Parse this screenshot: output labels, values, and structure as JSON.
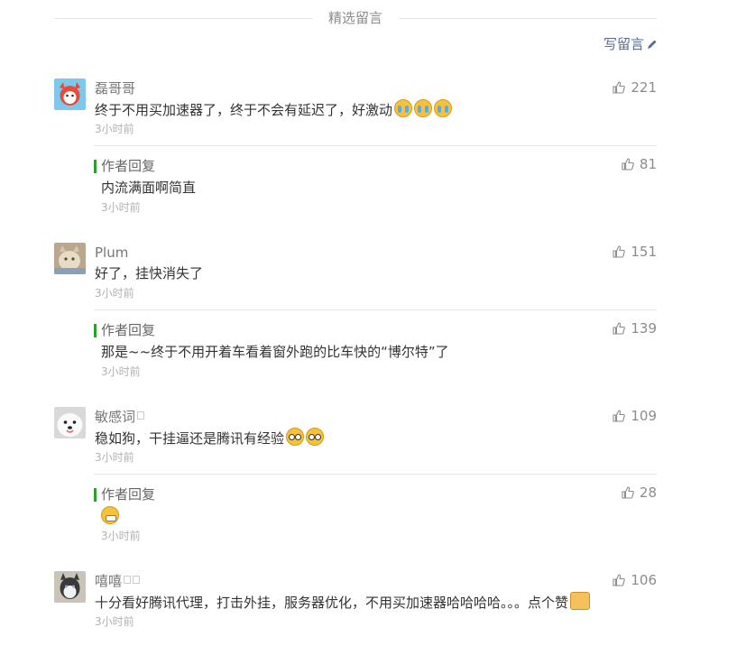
{
  "section_title": "精选留言",
  "write_label": "写留言",
  "colors": {
    "link": "#576b95",
    "reply_bar": "#2ca02c",
    "meta": "#b2b2b2"
  },
  "comments": [
    {
      "nickname": "磊哥哥",
      "text": "终于不用买加速器了，终于不会有延迟了，好激动",
      "emojis": [
        "cry",
        "cry",
        "cry"
      ],
      "time": "3小时前",
      "likes": "221",
      "reply": {
        "label": "作者回复",
        "text": "内流满面啊简直",
        "time": "3小时前",
        "likes": "81"
      }
    },
    {
      "nickname": "Plum",
      "text": "好了，挂快消失了",
      "time": "3小时前",
      "likes": "151",
      "reply": {
        "label": "作者回复",
        "text": "那是~~终于不用开着车看着窗外跑的比车快的“博尔特”了",
        "time": "3小时前",
        "likes": "139"
      }
    },
    {
      "nickname": "敏感词",
      "text": "稳如狗，干挂逼还是腾讯有经验",
      "emojis": [
        "shy",
        "shy"
      ],
      "time": "3小时前",
      "likes": "109",
      "reply": {
        "label": "作者回复",
        "text": "",
        "emojis": [
          "grin"
        ],
        "time": "3小时前",
        "likes": "28"
      }
    },
    {
      "nickname": "嘻嘻",
      "text": "十分看好腾讯代理，打击外挂，服务器优化，不用买加速器哈哈哈哈。。。点个赞",
      "emojis": [
        "thumbs-up"
      ],
      "time": "3小时前",
      "likes": "106"
    }
  ]
}
